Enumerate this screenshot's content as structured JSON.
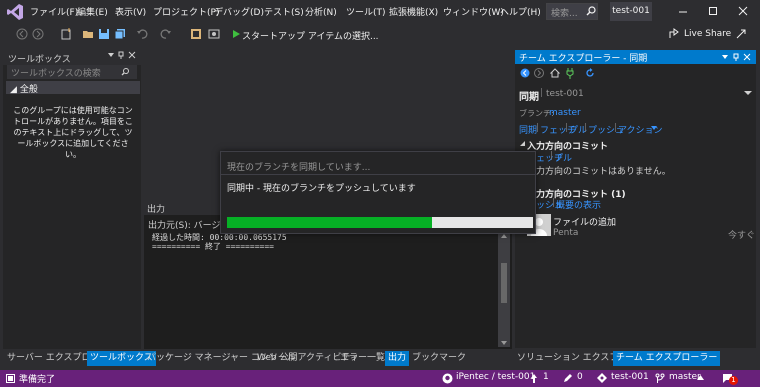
{
  "menu": {
    "items": [
      "ファイル(F)",
      "編集(E)",
      "表示(V)",
      "プロジェクト(P)",
      "デバッグ(D)",
      "テスト(S)",
      "分析(N)",
      "ツール(T)",
      "拡張機能(X)",
      "ウィンドウ(W)",
      "ヘルプ(H)"
    ],
    "search_placeholder": "検索...",
    "solution_name": "test-001"
  },
  "toolbar": {
    "start_label": "スタートアップ アイテムの選択...",
    "liveshare_label": "Live Share"
  },
  "toolbox": {
    "title": "ツールボックス",
    "search_placeholder": "ツールボックスの検索",
    "group": "全般",
    "empty_message": "このグループには使用可能なコントロールがありません。項目をこのテキスト上にドラッグして、ツールボックスに追加してください。"
  },
  "left_tabs": [
    "サーバー エクスプローラー",
    "ツールボックス"
  ],
  "bottom_tabs": [
    "パッケージ マネージャー コンソール",
    "Web 公開アクティビティ",
    "エラー一覧...",
    "出力",
    "ブックマーク"
  ],
  "output": {
    "title": "出力",
    "source_label": "出力元(S):",
    "source_value": "バージ",
    "lines": [
      "経過した時間: 00:00:00.0655175",
      "========== 終了 =========="
    ]
  },
  "team": {
    "header": "チーム エクスプローラー - 同期",
    "title": "同期",
    "repo": "test-001",
    "branch_label": "ブランチ:",
    "branch": "master",
    "actions": [
      "同期",
      "フェッチ",
      "プル",
      "プッシュ",
      "アクション"
    ],
    "incoming_title": "入力方向のコミット",
    "incoming_links": [
      "フェッチ",
      "プル"
    ],
    "incoming_empty": "入力方向のコミットはありません。",
    "outgoing_title": "出力方向のコミット (1)",
    "outgoing_links": [
      "プッシュ",
      "概要の表示"
    ],
    "commit_message": "ファイルの追加",
    "commit_author": "Penta",
    "commit_time": "今すぐ"
  },
  "right_tabs": [
    "ソリューション エクスプローラー",
    "チーム エクスプローラー"
  ],
  "dialog": {
    "title": "現在のブランチを同期しています...",
    "message": "同期中 - 現在のブランチをプッシュしています",
    "progress": 0.67
  },
  "status": {
    "ready": "準備完了",
    "repo": "iPentec / test-001",
    "up_count": "1",
    "edit_count": "0",
    "project": "test-001",
    "branch": "master",
    "notifications": "1"
  },
  "colors": {
    "accent": "#007acc",
    "status_bar": "#68217a",
    "progress": "#06b025",
    "link": "#3794ff"
  }
}
